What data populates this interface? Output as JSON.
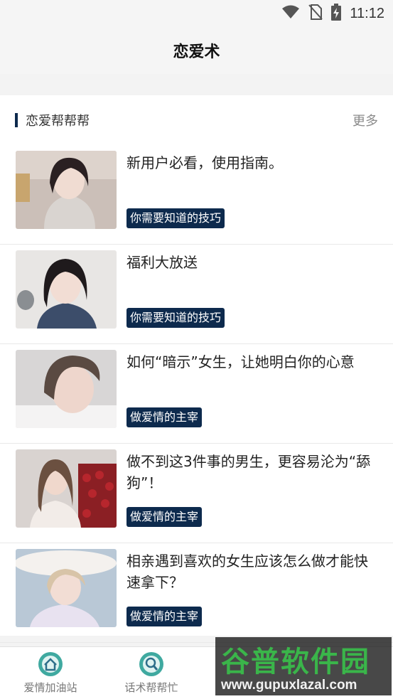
{
  "status_bar": {
    "time": "11:12"
  },
  "header": {
    "title": "恋爱术"
  },
  "section": {
    "title": "恋爱帮帮帮",
    "more": "更多"
  },
  "articles": [
    {
      "title": "新用户必看，使用指南。",
      "tag": "你需要知道的技巧"
    },
    {
      "title": "福利大放送",
      "tag": "你需要知道的技巧"
    },
    {
      "title": "如何“暗示”女生，让她明白你的心意",
      "tag": "做爱情的主宰"
    },
    {
      "title": "做不到这3件事的男生，更容易沦为“舔狗”！",
      "tag": "做爱情的主宰"
    },
    {
      "title": "相亲遇到喜欢的女生应该怎么做才能快速拿下？",
      "tag": "做爱情的主宰"
    }
  ],
  "tabs": [
    {
      "label": "爱情加油站",
      "icon": "home-icon"
    },
    {
      "label": "话术帮帮忙",
      "icon": "search-icon"
    }
  ],
  "watermark": {
    "text": "谷普软件园",
    "url": "www.gupuxlazal.com"
  },
  "colors": {
    "accent": "#0d2a4d",
    "tab_icon": "#3fa9a0",
    "watermark_green": "#3ab54a"
  }
}
